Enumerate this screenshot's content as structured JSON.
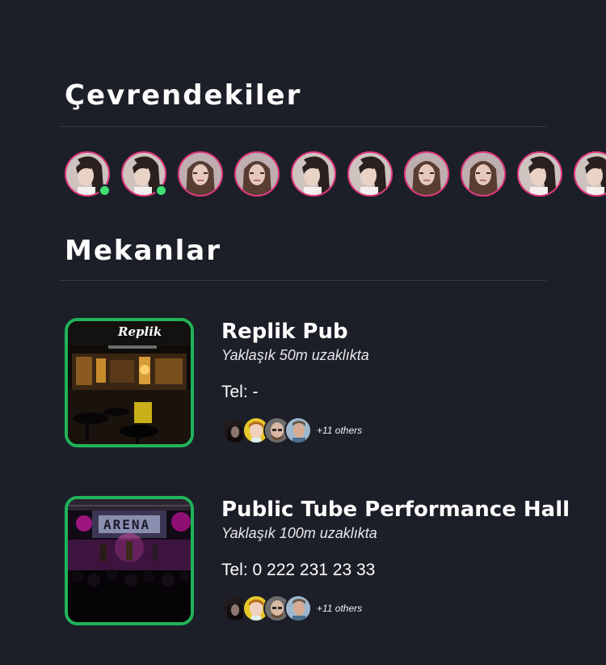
{
  "people_section": {
    "title": "Çevrendekiler",
    "people": [
      {
        "avatar": "person-a",
        "online": true
      },
      {
        "avatar": "person-a",
        "online": true
      },
      {
        "avatar": "person-b",
        "online": false
      },
      {
        "avatar": "person-b",
        "online": false
      },
      {
        "avatar": "person-a",
        "online": false
      },
      {
        "avatar": "person-a",
        "online": false
      },
      {
        "avatar": "person-b",
        "online": false
      },
      {
        "avatar": "person-b",
        "online": false
      },
      {
        "avatar": "person-a",
        "online": false
      },
      {
        "avatar": "person-a",
        "online": false
      }
    ]
  },
  "venues_section": {
    "title": "Mekanlar",
    "venues": [
      {
        "name": "Replik Pub",
        "distance": "Yaklaşık 50m uzaklıkta",
        "phone": "Tel: -",
        "image_sign": "Replik",
        "others": "+11 others"
      },
      {
        "name": "Public Tube Performance Hall",
        "distance": "Yaklaşık 100m uzaklıkta",
        "phone": "Tel: 0 222 231 23 33",
        "image_sign": "ARENA",
        "others": "+11 others"
      }
    ]
  },
  "colors": {
    "background": "#1c1f27",
    "avatar_ring": "#e4357e",
    "online": "#3fdd72",
    "venue_border": "#1fb45a"
  }
}
